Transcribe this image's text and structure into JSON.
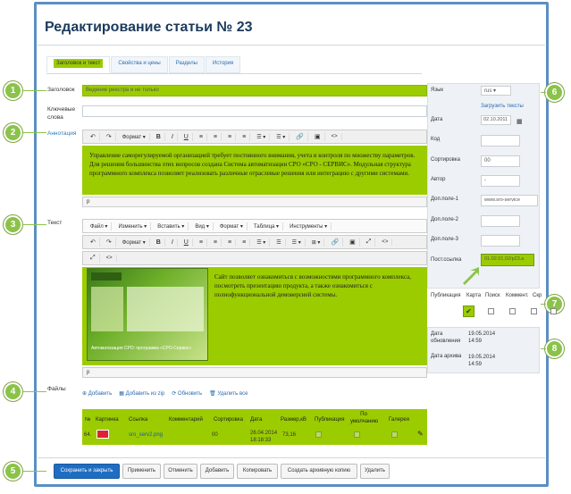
{
  "page": {
    "title": "Редактирование статьи № 23",
    "tabs": [
      "Заголовок и текст",
      "Свойства и цены",
      "Разделы",
      "История"
    ]
  },
  "badges": [
    "1",
    "2",
    "3",
    "4",
    "5",
    "6",
    "7",
    "8"
  ],
  "form": {
    "title_label": "Заголовок",
    "title_value": "Ведение реестра и не только",
    "keywords_label": "Ключевые слова",
    "annotation_label": "Аннотация",
    "text_label": "Текст",
    "files_label": "Файлы"
  },
  "annotation_editor": {
    "toolbar": [
      "↶",
      "↷",
      "Формат ▾",
      "B",
      "I",
      "U",
      "≡",
      "≡",
      "≡",
      "≡",
      "☰ ▾",
      "☰ ▾",
      "🔗",
      "▣",
      "<>"
    ],
    "body": "Управление саморегулируемой организацией требует постоянного внимания, учета и контроля по множеству параметров. Для решения большинства этих вопросов создана Система автоматизации СРО «СРО - СЕРВИС». Модульная структура программного комплекса позволяет реализовать различные отраслевые решения или интеграцию с другими системами.",
    "status": "p"
  },
  "text_editor": {
    "menu": [
      "Файл ▾",
      "Изменить ▾",
      "Вставить ▾",
      "Вид ▾",
      "Формат ▾",
      "Таблица ▾",
      "Инструменты ▾"
    ],
    "toolbar": [
      "↶",
      "↷",
      "Формат ▾",
      "B",
      "I",
      "U",
      "≡",
      "≡",
      "≡",
      "≡",
      "☰ ▾",
      "☰",
      "☰ ▾",
      "⊞ ▾",
      "🔗",
      "▣",
      "⤢",
      "<>"
    ],
    "toolbar2": [
      "⤢",
      "<>"
    ],
    "body": "Сайт позволяет ознакомиться с возможностями программного комплекса, посмотреть презентацию продукта, а также ознакомиться с полнофункциональной демоверсией системы.",
    "image_caption": "Автоматизация СРО: программа «СРО-Сервис»",
    "status": "p"
  },
  "files": {
    "actions": [
      "Добавить",
      "Добавить из zip",
      "Обновить",
      "Удалить все"
    ],
    "columns": [
      "№",
      "Картинка",
      "Ссылка",
      "Комментарий",
      "Сортировка",
      "Дата",
      "Размер,кВ",
      "Публикация",
      "По умолчанию",
      "Галерея"
    ],
    "rows": [
      {
        "num": "64.",
        "link": "sro_serv2.png",
        "comment": "",
        "sort": "00",
        "date": "26.04.2014 18:18:33",
        "size": "73,16"
      }
    ]
  },
  "right_panel": {
    "lang_label": "Язык",
    "lang_value": "rus",
    "load_texts": "Загрузить тексты",
    "date_label": "Дата",
    "date_value": "02.10.2011",
    "code_label": "Код",
    "sort_label": "Сортировка",
    "sort_value": "00",
    "author_label": "Автор",
    "author_value": "-",
    "extra1_label": "Доп.поле-1",
    "extra1_value": "www.sro-service",
    "extra2_label": "Доп.поле-2",
    "extra3_label": "Доп.поле-3",
    "permalink_label": "Пост.ссылка",
    "permalink_value": "01.02.01.02/p23.a",
    "flags": [
      "Публикация",
      "Карта",
      "Поиск",
      "Коммент.",
      "Скр"
    ],
    "updated_label": "Дата обновления",
    "updated_value": "19.05.2014 14:59",
    "archive_label": "Дата архива",
    "archive_value": "19.05.2014 14:59"
  },
  "buttons": [
    "Сохранить и закрыть",
    "Применить",
    "Отменить",
    "Добавить",
    "Копировать",
    "Создать архивную копию",
    "Удалить"
  ],
  "colors": {
    "accent": "#9bcc00",
    "badge": "#8bc34a",
    "frame": "#5a8fc4",
    "primary": "#1f6dc2"
  }
}
